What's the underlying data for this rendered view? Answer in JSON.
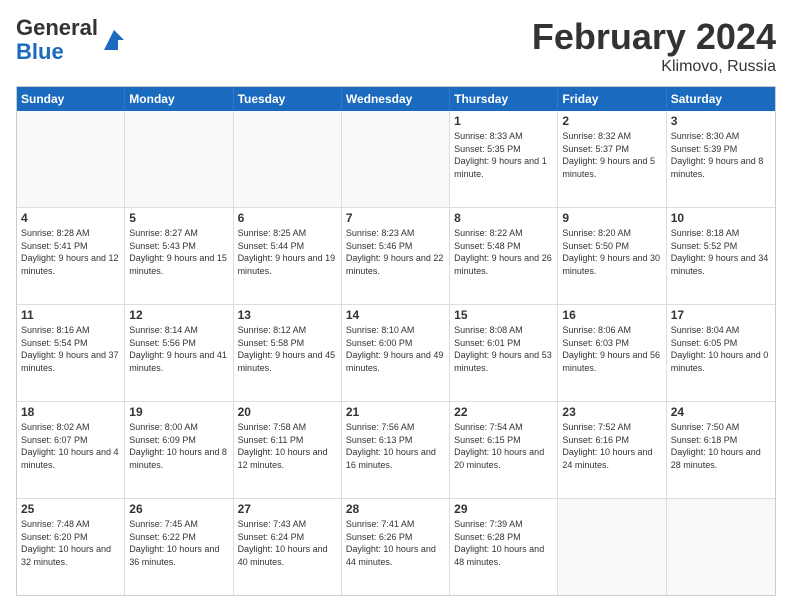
{
  "header": {
    "logo_general": "General",
    "logo_blue": "Blue",
    "month_year": "February 2024",
    "location": "Klimovo, Russia"
  },
  "weekdays": [
    "Sunday",
    "Monday",
    "Tuesday",
    "Wednesday",
    "Thursday",
    "Friday",
    "Saturday"
  ],
  "rows": [
    [
      {
        "day": "",
        "text": "",
        "empty": true
      },
      {
        "day": "",
        "text": "",
        "empty": true
      },
      {
        "day": "",
        "text": "",
        "empty": true
      },
      {
        "day": "",
        "text": "",
        "empty": true
      },
      {
        "day": "1",
        "text": "Sunrise: 8:33 AM\nSunset: 5:35 PM\nDaylight: 9 hours and 1 minute."
      },
      {
        "day": "2",
        "text": "Sunrise: 8:32 AM\nSunset: 5:37 PM\nDaylight: 9 hours and 5 minutes."
      },
      {
        "day": "3",
        "text": "Sunrise: 8:30 AM\nSunset: 5:39 PM\nDaylight: 9 hours and 8 minutes."
      }
    ],
    [
      {
        "day": "4",
        "text": "Sunrise: 8:28 AM\nSunset: 5:41 PM\nDaylight: 9 hours and 12 minutes."
      },
      {
        "day": "5",
        "text": "Sunrise: 8:27 AM\nSunset: 5:43 PM\nDaylight: 9 hours and 15 minutes."
      },
      {
        "day": "6",
        "text": "Sunrise: 8:25 AM\nSunset: 5:44 PM\nDaylight: 9 hours and 19 minutes."
      },
      {
        "day": "7",
        "text": "Sunrise: 8:23 AM\nSunset: 5:46 PM\nDaylight: 9 hours and 22 minutes."
      },
      {
        "day": "8",
        "text": "Sunrise: 8:22 AM\nSunset: 5:48 PM\nDaylight: 9 hours and 26 minutes."
      },
      {
        "day": "9",
        "text": "Sunrise: 8:20 AM\nSunset: 5:50 PM\nDaylight: 9 hours and 30 minutes."
      },
      {
        "day": "10",
        "text": "Sunrise: 8:18 AM\nSunset: 5:52 PM\nDaylight: 9 hours and 34 minutes."
      }
    ],
    [
      {
        "day": "11",
        "text": "Sunrise: 8:16 AM\nSunset: 5:54 PM\nDaylight: 9 hours and 37 minutes."
      },
      {
        "day": "12",
        "text": "Sunrise: 8:14 AM\nSunset: 5:56 PM\nDaylight: 9 hours and 41 minutes."
      },
      {
        "day": "13",
        "text": "Sunrise: 8:12 AM\nSunset: 5:58 PM\nDaylight: 9 hours and 45 minutes."
      },
      {
        "day": "14",
        "text": "Sunrise: 8:10 AM\nSunset: 6:00 PM\nDaylight: 9 hours and 49 minutes."
      },
      {
        "day": "15",
        "text": "Sunrise: 8:08 AM\nSunset: 6:01 PM\nDaylight: 9 hours and 53 minutes."
      },
      {
        "day": "16",
        "text": "Sunrise: 8:06 AM\nSunset: 6:03 PM\nDaylight: 9 hours and 56 minutes."
      },
      {
        "day": "17",
        "text": "Sunrise: 8:04 AM\nSunset: 6:05 PM\nDaylight: 10 hours and 0 minutes."
      }
    ],
    [
      {
        "day": "18",
        "text": "Sunrise: 8:02 AM\nSunset: 6:07 PM\nDaylight: 10 hours and 4 minutes."
      },
      {
        "day": "19",
        "text": "Sunrise: 8:00 AM\nSunset: 6:09 PM\nDaylight: 10 hours and 8 minutes."
      },
      {
        "day": "20",
        "text": "Sunrise: 7:58 AM\nSunset: 6:11 PM\nDaylight: 10 hours and 12 minutes."
      },
      {
        "day": "21",
        "text": "Sunrise: 7:56 AM\nSunset: 6:13 PM\nDaylight: 10 hours and 16 minutes."
      },
      {
        "day": "22",
        "text": "Sunrise: 7:54 AM\nSunset: 6:15 PM\nDaylight: 10 hours and 20 minutes."
      },
      {
        "day": "23",
        "text": "Sunrise: 7:52 AM\nSunset: 6:16 PM\nDaylight: 10 hours and 24 minutes."
      },
      {
        "day": "24",
        "text": "Sunrise: 7:50 AM\nSunset: 6:18 PM\nDaylight: 10 hours and 28 minutes."
      }
    ],
    [
      {
        "day": "25",
        "text": "Sunrise: 7:48 AM\nSunset: 6:20 PM\nDaylight: 10 hours and 32 minutes."
      },
      {
        "day": "26",
        "text": "Sunrise: 7:45 AM\nSunset: 6:22 PM\nDaylight: 10 hours and 36 minutes."
      },
      {
        "day": "27",
        "text": "Sunrise: 7:43 AM\nSunset: 6:24 PM\nDaylight: 10 hours and 40 minutes."
      },
      {
        "day": "28",
        "text": "Sunrise: 7:41 AM\nSunset: 6:26 PM\nDaylight: 10 hours and 44 minutes."
      },
      {
        "day": "29",
        "text": "Sunrise: 7:39 AM\nSunset: 6:28 PM\nDaylight: 10 hours and 48 minutes."
      },
      {
        "day": "",
        "text": "",
        "empty": true
      },
      {
        "day": "",
        "text": "",
        "empty": true
      }
    ]
  ]
}
